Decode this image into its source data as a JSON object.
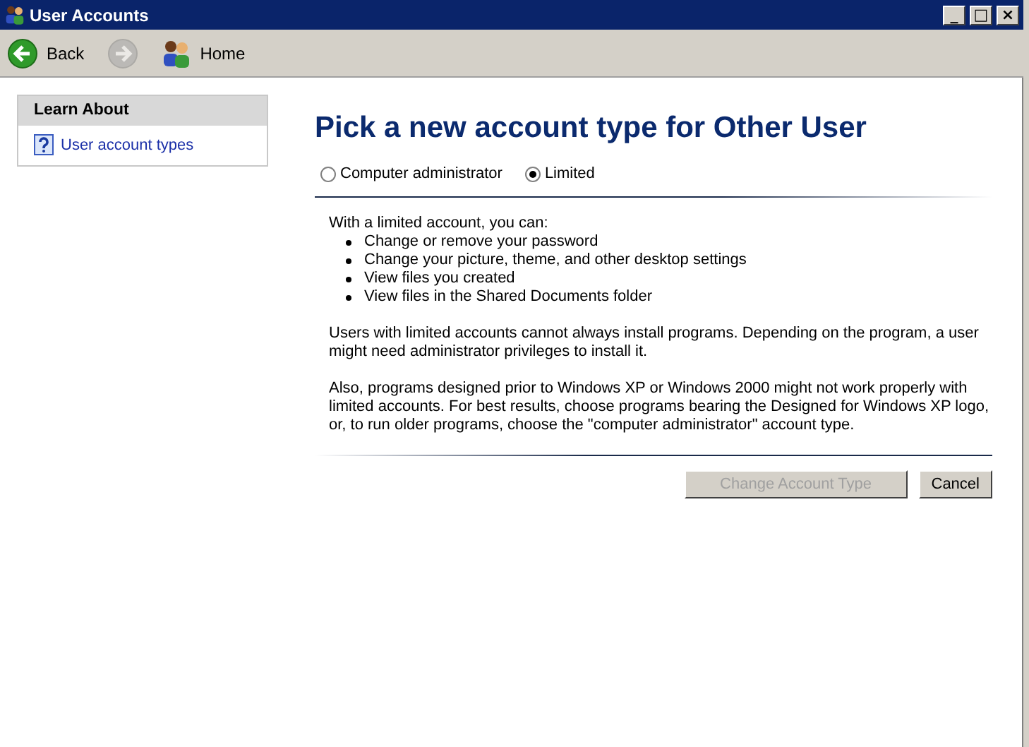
{
  "window": {
    "title": "User Accounts",
    "controls": [
      "_",
      "□",
      "×"
    ]
  },
  "toolbar": [
    {
      "label": "Back",
      "kind": "back",
      "disabled": false
    },
    {
      "kind": "forward",
      "disabled": true
    },
    {
      "label": "Home",
      "kind": "home",
      "disabled": false
    }
  ],
  "sidebar": {
    "heading": "Learn About",
    "items": [
      {
        "label": "User account types"
      }
    ]
  },
  "heading": "Pick a new account type for Other User",
  "account_types": [
    {
      "label": "Computer administrator",
      "selected": false
    },
    {
      "label": "Limited",
      "selected": true
    }
  ],
  "intro": "With a limited account, you can:",
  "bullets": [
    "Change or remove your password",
    "Change your picture, theme, and other desktop settings",
    "View files you created",
    "View files in the Shared Documents folder"
  ],
  "paragraphs": [
    "Users with limited accounts cannot always install programs. Depending on the program, a user might need administrator privileges to install it.",
    "Also, programs designed prior to Windows XP or Windows 2000 might not work properly with limited accounts. For best results, choose programs bearing the Designed for Windows XP logo, or, to run older programs, choose the \"computer administrator\" account type."
  ],
  "buttons": [
    {
      "label": "Change Account Type",
      "disabled": true
    },
    {
      "label": "Cancel",
      "disabled": false
    }
  ]
}
